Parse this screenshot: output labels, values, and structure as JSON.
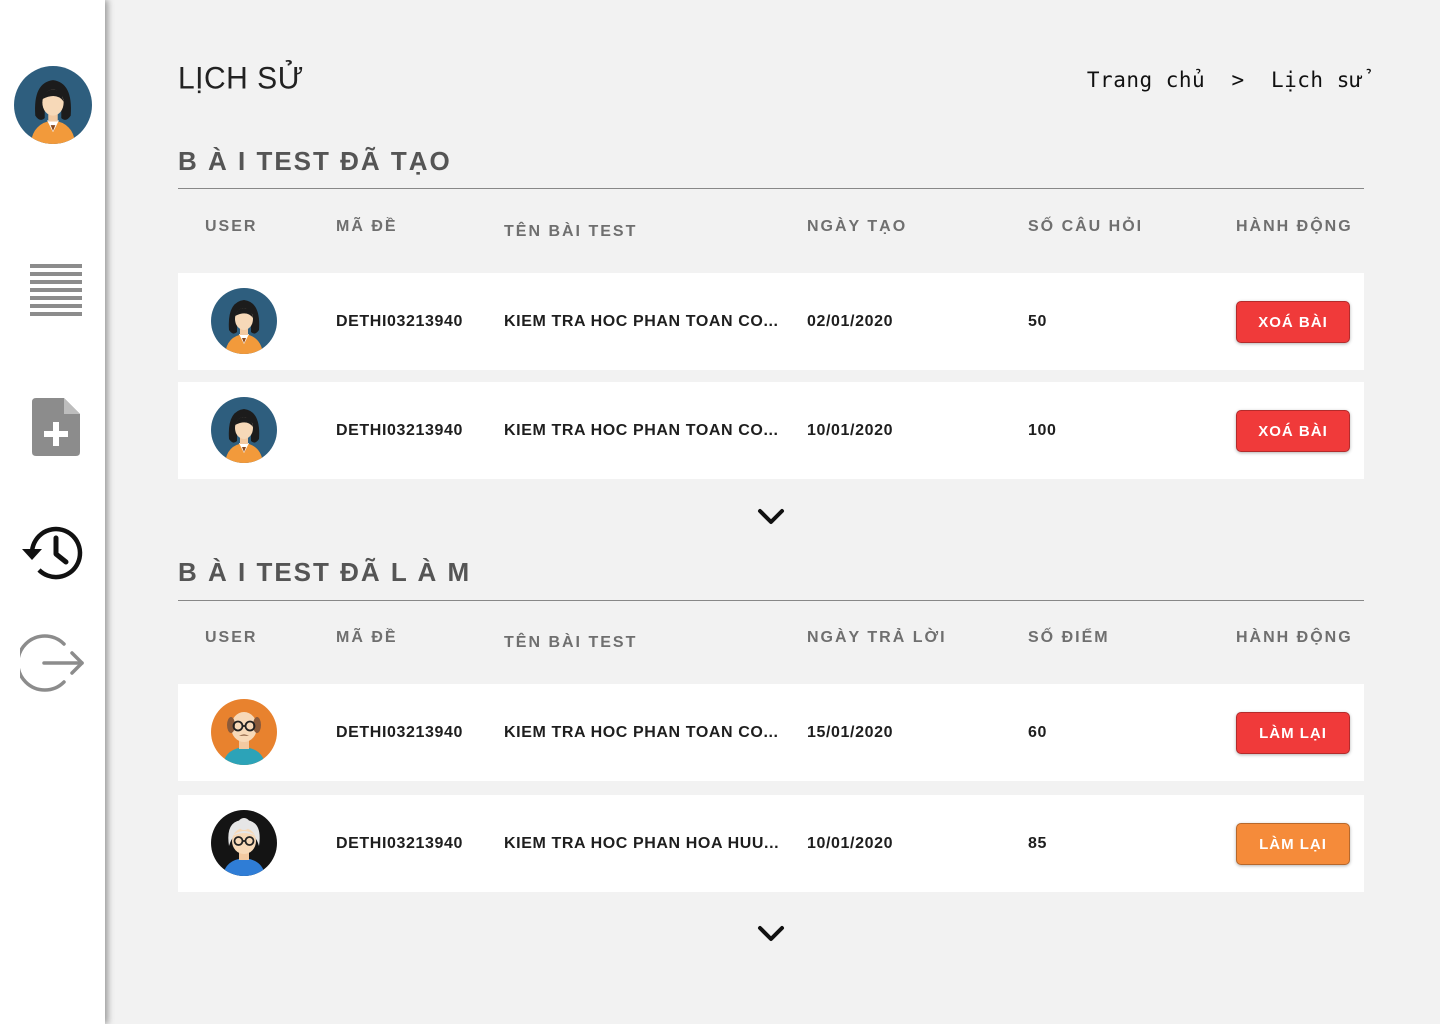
{
  "page": {
    "title": "LỊCH SỬ",
    "breadcrumb": {
      "home": "Trang chủ",
      "separator": ">",
      "current": "Lịch sử"
    }
  },
  "sidebar": {
    "avatar_icon": "female-user-avatar",
    "items": [
      {
        "icon": "list-icon"
      },
      {
        "icon": "new-document-icon"
      },
      {
        "icon": "history-icon",
        "active": true
      },
      {
        "icon": "logout-icon"
      }
    ]
  },
  "created_tests": {
    "title": "B À I TEST ĐÃ TẠO",
    "headers": [
      "USER",
      "MÃ ĐỀ",
      "TÊN BÀI TEST",
      "NGÀY TẠO",
      "SỐ CÂU HỎI",
      "HÀNH ĐỘNG"
    ],
    "rows": [
      {
        "avatar": "female-avatar",
        "code": "DETHI03213940",
        "name": "KIEM TRA HOC PHAN TOAN CO...",
        "date": "02/01/2020",
        "value": "50",
        "action": "XOÁ BÀI",
        "action_color": "#f03a3a"
      },
      {
        "avatar": "female-avatar",
        "code": "DETHI03213940",
        "name": "KIEM TRA HOC PHAN TOAN CO...",
        "date": "10/01/2020",
        "value": "100",
        "action": "XOÁ BÀI",
        "action_color": "#f03a3a"
      }
    ]
  },
  "taken_tests": {
    "title": "B À I TEST ĐÃ L À M",
    "headers": [
      "USER",
      "MÃ ĐỀ",
      "TÊN BÀI TEST",
      "NGÀY TRẢ LỜI",
      "SỐ ĐIỂM",
      "HÀNH ĐỘNG"
    ],
    "rows": [
      {
        "avatar": "bald-man-avatar",
        "code": "DETHI03213940",
        "name": "KIEM TRA HOC PHAN TOAN CO...",
        "date": "15/01/2020",
        "value": "60",
        "action": "LÀM LẠI",
        "action_color": "#f03a3a"
      },
      {
        "avatar": "grandma-avatar",
        "code": "DETHI03213940",
        "name": "KIEM TRA HOC PHAN HOA HUU...",
        "date": "10/01/2020",
        "value": "85",
        "action": "LÀM LẠI",
        "action_color": "#f58b3a"
      }
    ]
  },
  "colors": {
    "background": "#f2f2f2",
    "danger": "#f03a3a",
    "warning": "#f58b3a",
    "text_muted": "#6f6f6f"
  }
}
